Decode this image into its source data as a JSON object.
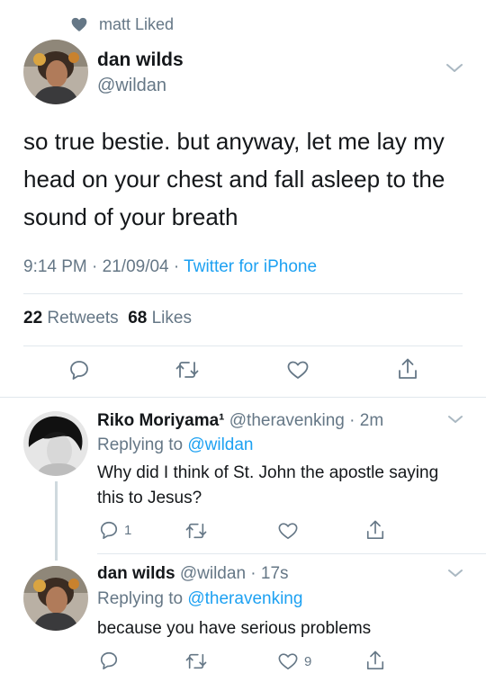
{
  "social_context": {
    "text": "matt Liked"
  },
  "main_tweet": {
    "author_name": "dan wilds",
    "author_handle": "@wildan",
    "text": "so true bestie. but anyway, let me lay my head on your chest and fall asleep to the sound of your breath",
    "time": "9:14 PM",
    "date": "21/09/04",
    "source": "Twitter for iPhone",
    "retweets_count": "22",
    "retweets_label": "Retweets",
    "likes_count": "68",
    "likes_label": "Likes"
  },
  "replies": [
    {
      "author_name": "Riko Moriyama¹",
      "author_handle": "@theravenking",
      "time": "2m",
      "replying_prefix": "Replying to",
      "replying_to": "@wildan",
      "text": "Why did I think of St. John the apostle saying this to Jesus?",
      "reply_count": "1",
      "retweet_count": "",
      "like_count": ""
    },
    {
      "author_name": "dan wilds",
      "author_handle": "@wildan",
      "time": "17s",
      "replying_prefix": "Replying to",
      "replying_to": "@theravenking",
      "text": "because you have serious problems",
      "reply_count": "",
      "retweet_count": "",
      "like_count": "9"
    }
  ],
  "separator": " · ",
  "colors": {
    "accent": "#1da1f2",
    "secondary_text": "#657786",
    "primary_text": "#14171a",
    "divider": "#e1e8ed"
  },
  "icons": [
    "heart-icon",
    "chevron-down-icon",
    "reply-icon",
    "retweet-icon",
    "like-icon",
    "share-icon"
  ]
}
